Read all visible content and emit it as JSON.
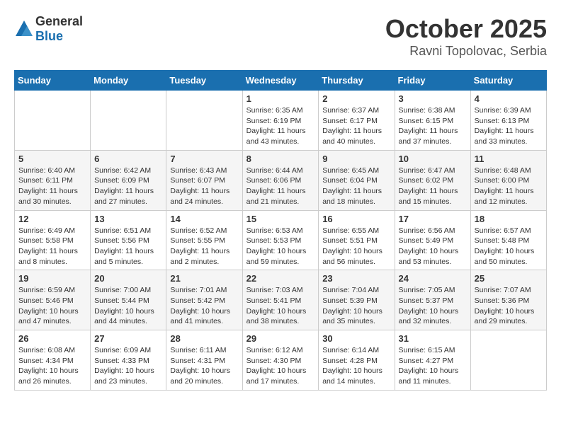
{
  "header": {
    "logo": {
      "general": "General",
      "blue": "Blue"
    },
    "month": "October 2025",
    "location": "Ravni Topolovac, Serbia"
  },
  "weekdays": [
    "Sunday",
    "Monday",
    "Tuesday",
    "Wednesday",
    "Thursday",
    "Friday",
    "Saturday"
  ],
  "weeks": [
    [
      {
        "day": "",
        "info": ""
      },
      {
        "day": "",
        "info": ""
      },
      {
        "day": "",
        "info": ""
      },
      {
        "day": "1",
        "info": "Sunrise: 6:35 AM\nSunset: 6:19 PM\nDaylight: 11 hours\nand 43 minutes."
      },
      {
        "day": "2",
        "info": "Sunrise: 6:37 AM\nSunset: 6:17 PM\nDaylight: 11 hours\nand 40 minutes."
      },
      {
        "day": "3",
        "info": "Sunrise: 6:38 AM\nSunset: 6:15 PM\nDaylight: 11 hours\nand 37 minutes."
      },
      {
        "day": "4",
        "info": "Sunrise: 6:39 AM\nSunset: 6:13 PM\nDaylight: 11 hours\nand 33 minutes."
      }
    ],
    [
      {
        "day": "5",
        "info": "Sunrise: 6:40 AM\nSunset: 6:11 PM\nDaylight: 11 hours\nand 30 minutes."
      },
      {
        "day": "6",
        "info": "Sunrise: 6:42 AM\nSunset: 6:09 PM\nDaylight: 11 hours\nand 27 minutes."
      },
      {
        "day": "7",
        "info": "Sunrise: 6:43 AM\nSunset: 6:07 PM\nDaylight: 11 hours\nand 24 minutes."
      },
      {
        "day": "8",
        "info": "Sunrise: 6:44 AM\nSunset: 6:06 PM\nDaylight: 11 hours\nand 21 minutes."
      },
      {
        "day": "9",
        "info": "Sunrise: 6:45 AM\nSunset: 6:04 PM\nDaylight: 11 hours\nand 18 minutes."
      },
      {
        "day": "10",
        "info": "Sunrise: 6:47 AM\nSunset: 6:02 PM\nDaylight: 11 hours\nand 15 minutes."
      },
      {
        "day": "11",
        "info": "Sunrise: 6:48 AM\nSunset: 6:00 PM\nDaylight: 11 hours\nand 12 minutes."
      }
    ],
    [
      {
        "day": "12",
        "info": "Sunrise: 6:49 AM\nSunset: 5:58 PM\nDaylight: 11 hours\nand 8 minutes."
      },
      {
        "day": "13",
        "info": "Sunrise: 6:51 AM\nSunset: 5:56 PM\nDaylight: 11 hours\nand 5 minutes."
      },
      {
        "day": "14",
        "info": "Sunrise: 6:52 AM\nSunset: 5:55 PM\nDaylight: 11 hours\nand 2 minutes."
      },
      {
        "day": "15",
        "info": "Sunrise: 6:53 AM\nSunset: 5:53 PM\nDaylight: 10 hours\nand 59 minutes."
      },
      {
        "day": "16",
        "info": "Sunrise: 6:55 AM\nSunset: 5:51 PM\nDaylight: 10 hours\nand 56 minutes."
      },
      {
        "day": "17",
        "info": "Sunrise: 6:56 AM\nSunset: 5:49 PM\nDaylight: 10 hours\nand 53 minutes."
      },
      {
        "day": "18",
        "info": "Sunrise: 6:57 AM\nSunset: 5:48 PM\nDaylight: 10 hours\nand 50 minutes."
      }
    ],
    [
      {
        "day": "19",
        "info": "Sunrise: 6:59 AM\nSunset: 5:46 PM\nDaylight: 10 hours\nand 47 minutes."
      },
      {
        "day": "20",
        "info": "Sunrise: 7:00 AM\nSunset: 5:44 PM\nDaylight: 10 hours\nand 44 minutes."
      },
      {
        "day": "21",
        "info": "Sunrise: 7:01 AM\nSunset: 5:42 PM\nDaylight: 10 hours\nand 41 minutes."
      },
      {
        "day": "22",
        "info": "Sunrise: 7:03 AM\nSunset: 5:41 PM\nDaylight: 10 hours\nand 38 minutes."
      },
      {
        "day": "23",
        "info": "Sunrise: 7:04 AM\nSunset: 5:39 PM\nDaylight: 10 hours\nand 35 minutes."
      },
      {
        "day": "24",
        "info": "Sunrise: 7:05 AM\nSunset: 5:37 PM\nDaylight: 10 hours\nand 32 minutes."
      },
      {
        "day": "25",
        "info": "Sunrise: 7:07 AM\nSunset: 5:36 PM\nDaylight: 10 hours\nand 29 minutes."
      }
    ],
    [
      {
        "day": "26",
        "info": "Sunrise: 6:08 AM\nSunset: 4:34 PM\nDaylight: 10 hours\nand 26 minutes."
      },
      {
        "day": "27",
        "info": "Sunrise: 6:09 AM\nSunset: 4:33 PM\nDaylight: 10 hours\nand 23 minutes."
      },
      {
        "day": "28",
        "info": "Sunrise: 6:11 AM\nSunset: 4:31 PM\nDaylight: 10 hours\nand 20 minutes."
      },
      {
        "day": "29",
        "info": "Sunrise: 6:12 AM\nSunset: 4:30 PM\nDaylight: 10 hours\nand 17 minutes."
      },
      {
        "day": "30",
        "info": "Sunrise: 6:14 AM\nSunset: 4:28 PM\nDaylight: 10 hours\nand 14 minutes."
      },
      {
        "day": "31",
        "info": "Sunrise: 6:15 AM\nSunset: 4:27 PM\nDaylight: 10 hours\nand 11 minutes."
      },
      {
        "day": "",
        "info": ""
      }
    ]
  ]
}
